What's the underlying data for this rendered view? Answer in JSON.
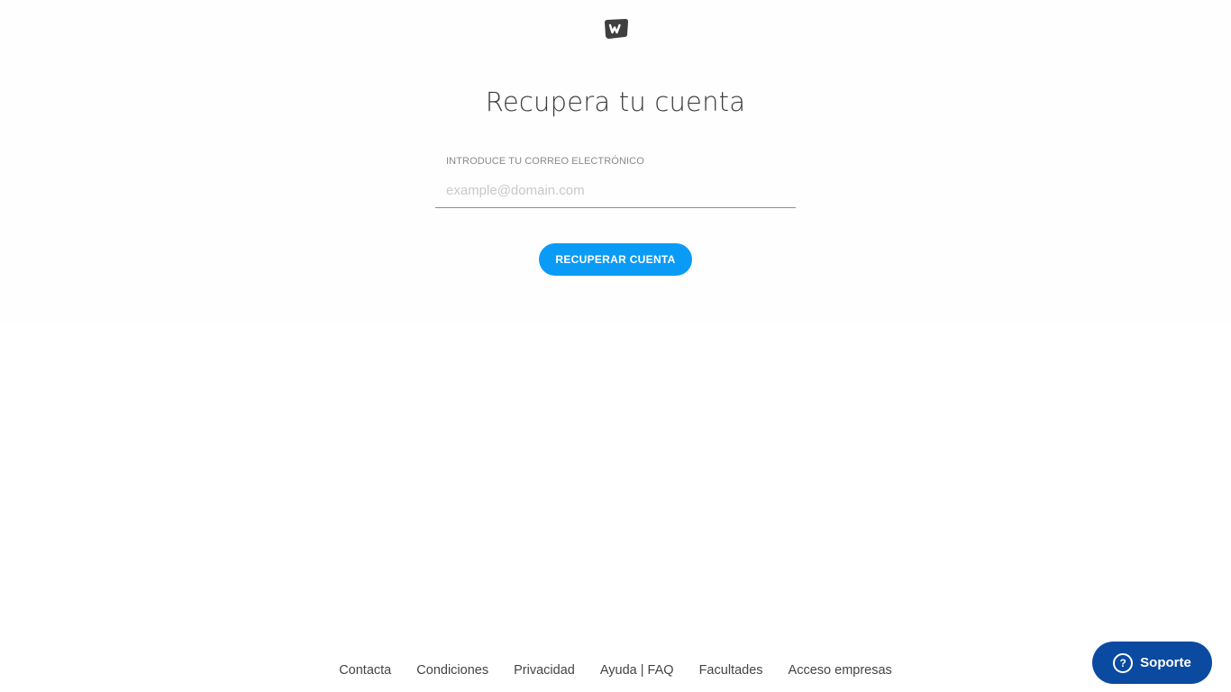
{
  "title": "Recupera tu cuenta",
  "form": {
    "email_label": "INTRODUCE TU CORREO ELECTRÓNICO",
    "email_placeholder": "example@domain.com",
    "email_value": "",
    "submit_label": "RECUPERAR CUENTA"
  },
  "footer": {
    "links": [
      "Contacta",
      "Condiciones",
      "Privacidad",
      "Ayuda | FAQ",
      "Facultades",
      "Acceso empresas"
    ]
  },
  "support": {
    "label": "Soporte",
    "icon": "question-icon"
  },
  "colors": {
    "primary_button": "#0a9bf7",
    "support_button": "#0a4aa0",
    "logo": "#3f3f3f"
  }
}
